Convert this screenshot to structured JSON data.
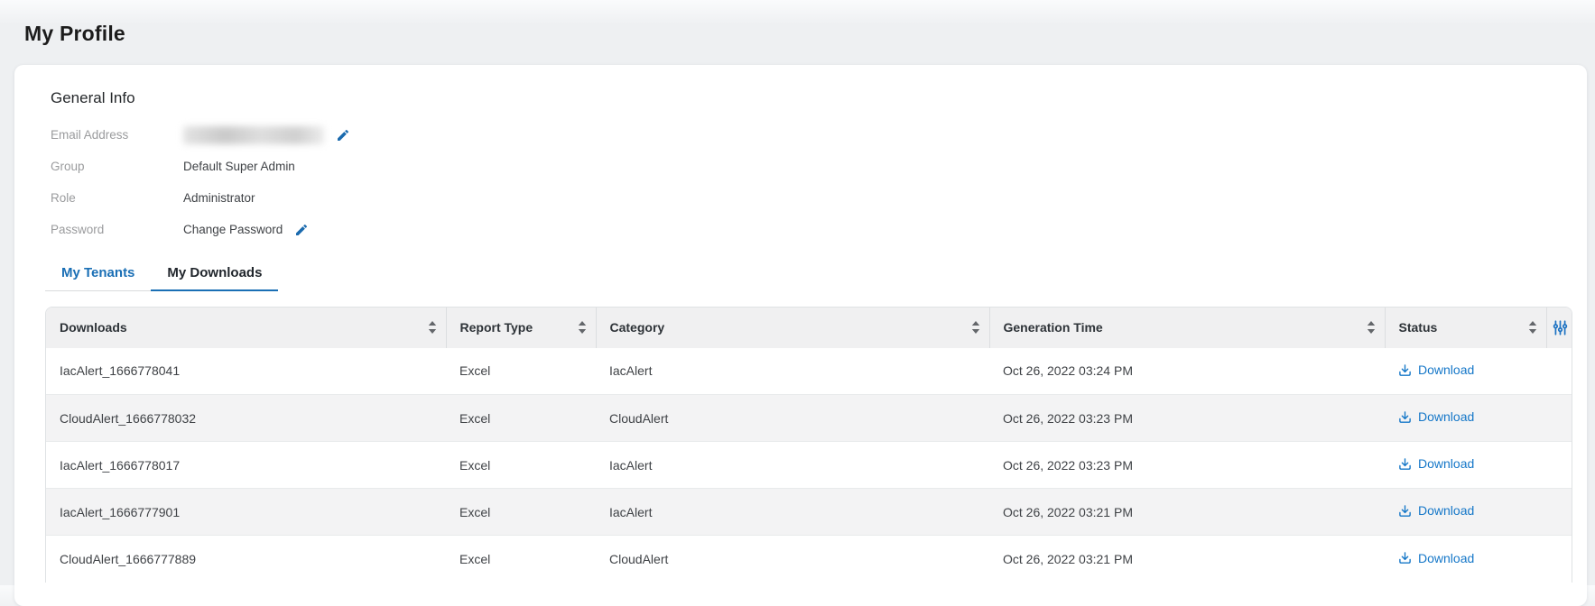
{
  "page": {
    "title": "My Profile"
  },
  "general_info": {
    "heading": "General Info",
    "fields": [
      {
        "label": "Email Address",
        "value": "",
        "redacted": true,
        "editable": true
      },
      {
        "label": "Group",
        "value": "Default Super Admin",
        "editable": false
      },
      {
        "label": "Role",
        "value": "Administrator",
        "editable": false
      },
      {
        "label": "Password",
        "value": "Change Password",
        "editable": true
      }
    ]
  },
  "tabs": [
    {
      "label": "My Tenants",
      "active": false
    },
    {
      "label": "My Downloads",
      "active": true
    }
  ],
  "table": {
    "columns": [
      {
        "label": "Downloads",
        "sortable": true
      },
      {
        "label": "Report Type",
        "sortable": true
      },
      {
        "label": "Category",
        "sortable": true
      },
      {
        "label": "Generation Time",
        "sortable": true
      },
      {
        "label": "Status",
        "sortable": true
      }
    ],
    "rows": [
      {
        "downloads": "IacAlert_1666778041",
        "report_type": "Excel",
        "category": "IacAlert",
        "generation_time": "Oct 26, 2022 03:24 PM",
        "status_action": "Download"
      },
      {
        "downloads": "CloudAlert_1666778032",
        "report_type": "Excel",
        "category": "CloudAlert",
        "generation_time": "Oct 26, 2022 03:23 PM",
        "status_action": "Download"
      },
      {
        "downloads": "IacAlert_1666778017",
        "report_type": "Excel",
        "category": "IacAlert",
        "generation_time": "Oct 26, 2022 03:23 PM",
        "status_action": "Download"
      },
      {
        "downloads": "IacAlert_1666777901",
        "report_type": "Excel",
        "category": "IacAlert",
        "generation_time": "Oct 26, 2022 03:21 PM",
        "status_action": "Download"
      },
      {
        "downloads": "CloudAlert_1666777889",
        "report_type": "Excel",
        "category": "CloudAlert",
        "generation_time": "Oct 26, 2022 03:21 PM",
        "status_action": "Download"
      }
    ]
  },
  "icons": {
    "edit": "pencil-icon",
    "download": "download-icon",
    "sort": "sort-icon",
    "filter": "column-filter-icon"
  },
  "colors": {
    "accent_blue": "#1a6fb5",
    "link_blue": "#1577c8",
    "icon_blue": "#1a6aae",
    "page_background": "#eef0f2",
    "card_background": "#ffffff",
    "table_header_background": "#f0f0f1",
    "row_stripe": "#f3f3f4",
    "label_gray": "#9a9b9d"
  }
}
